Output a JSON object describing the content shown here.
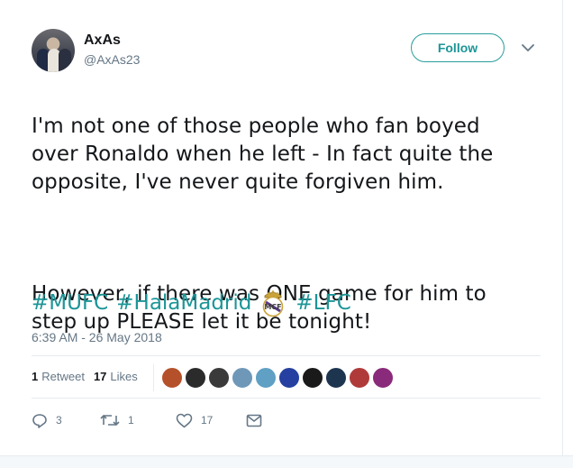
{
  "user": {
    "name": "AxAs",
    "handle": "@AxAs23"
  },
  "follow_label": "Follow",
  "tweet": {
    "paragraph1": "I'm not one of those people who fan boyed\nover Ronaldo when he left - In fact quite the\nopposite, I've never quite forgiven him.",
    "paragraph2": "However, if there was ONE game for him to\nstep up PLEASE let it be tonight!",
    "hashtags": [
      "#MUFC",
      "#HalaMadrid",
      "#LFC"
    ],
    "timestamp": "6:39 AM - 26 May 2018"
  },
  "stats": {
    "retweets_count": "1",
    "retweets_label": "Retweet",
    "likes_count": "17",
    "likes_label": "Likes"
  },
  "actions": {
    "reply_count": "3",
    "retweet_count": "1",
    "like_count": "17"
  },
  "likers_avatar_colors": [
    "#b5512a",
    "#2b2b2b",
    "#3a3a3a",
    "#6f98b8",
    "#5fa0c4",
    "#2540a0",
    "#1a1a1a",
    "#1e3550",
    "#b03a3a",
    "#8a2a7a"
  ],
  "colors": {
    "accent": "#1c9597",
    "secondary_text": "#657786",
    "primary_text": "#14171a"
  },
  "icons": [
    "chevron-down-icon",
    "real-madrid-crest-icon",
    "reply-icon",
    "retweet-icon",
    "like-icon",
    "direct-message-icon"
  ]
}
